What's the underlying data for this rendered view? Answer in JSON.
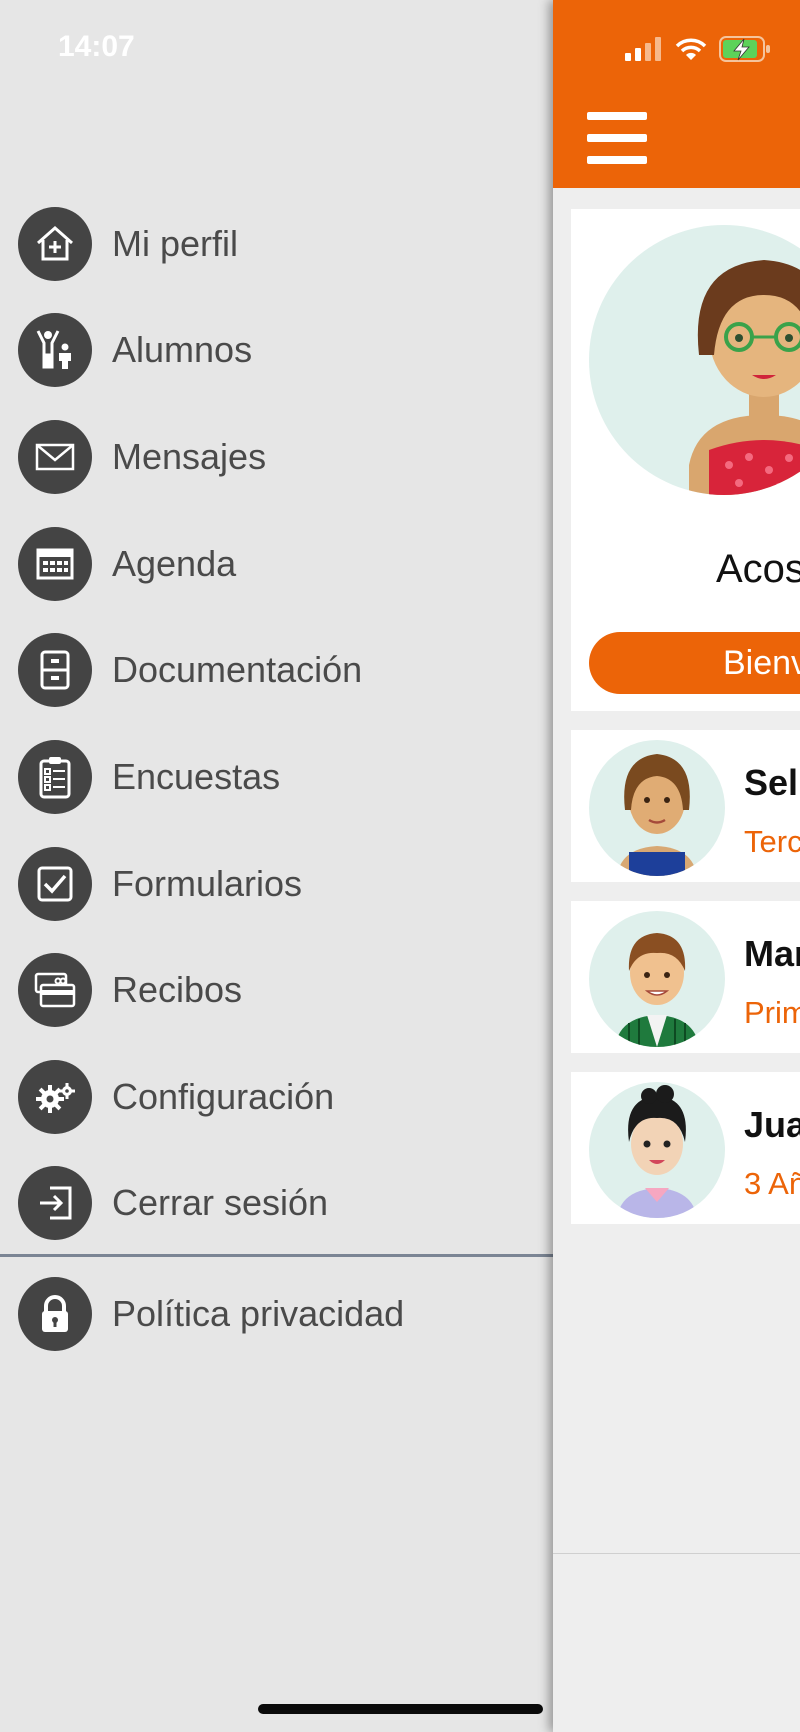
{
  "status_bar": {
    "time": "14:07"
  },
  "menu": {
    "items": [
      {
        "label": "Mi perfil",
        "icon": "house-plus-icon"
      },
      {
        "label": "Alumnos",
        "icon": "people-icon"
      },
      {
        "label": "Mensajes",
        "icon": "envelope-icon"
      },
      {
        "label": "Agenda",
        "icon": "calendar-icon"
      },
      {
        "label": "Documentación",
        "icon": "cabinet-icon"
      },
      {
        "label": "Encuestas",
        "icon": "clipboard-icon"
      },
      {
        "label": "Formularios",
        "icon": "checkbox-icon"
      },
      {
        "label": "Recibos",
        "icon": "card-icon"
      },
      {
        "label": "Configuración",
        "icon": "gears-icon"
      },
      {
        "label": "Cerrar sesión",
        "icon": "logout-icon"
      }
    ],
    "footer_items": [
      {
        "label": "Política privacidad",
        "icon": "lock-icon"
      }
    ]
  },
  "main": {
    "profile": {
      "name": "Acos",
      "welcome_label": "Bienv"
    },
    "students": [
      {
        "name": "Sel",
        "grade": "Terc"
      },
      {
        "name": "Mar",
        "grade": "Prim"
      },
      {
        "name": "Jua",
        "grade": "3 Añ"
      }
    ]
  },
  "colors": {
    "accent": "#ec6408",
    "menu_icon_bg": "#444444",
    "menu_bg": "#e6e6e6",
    "avatar_bg": "#dff0ec"
  }
}
